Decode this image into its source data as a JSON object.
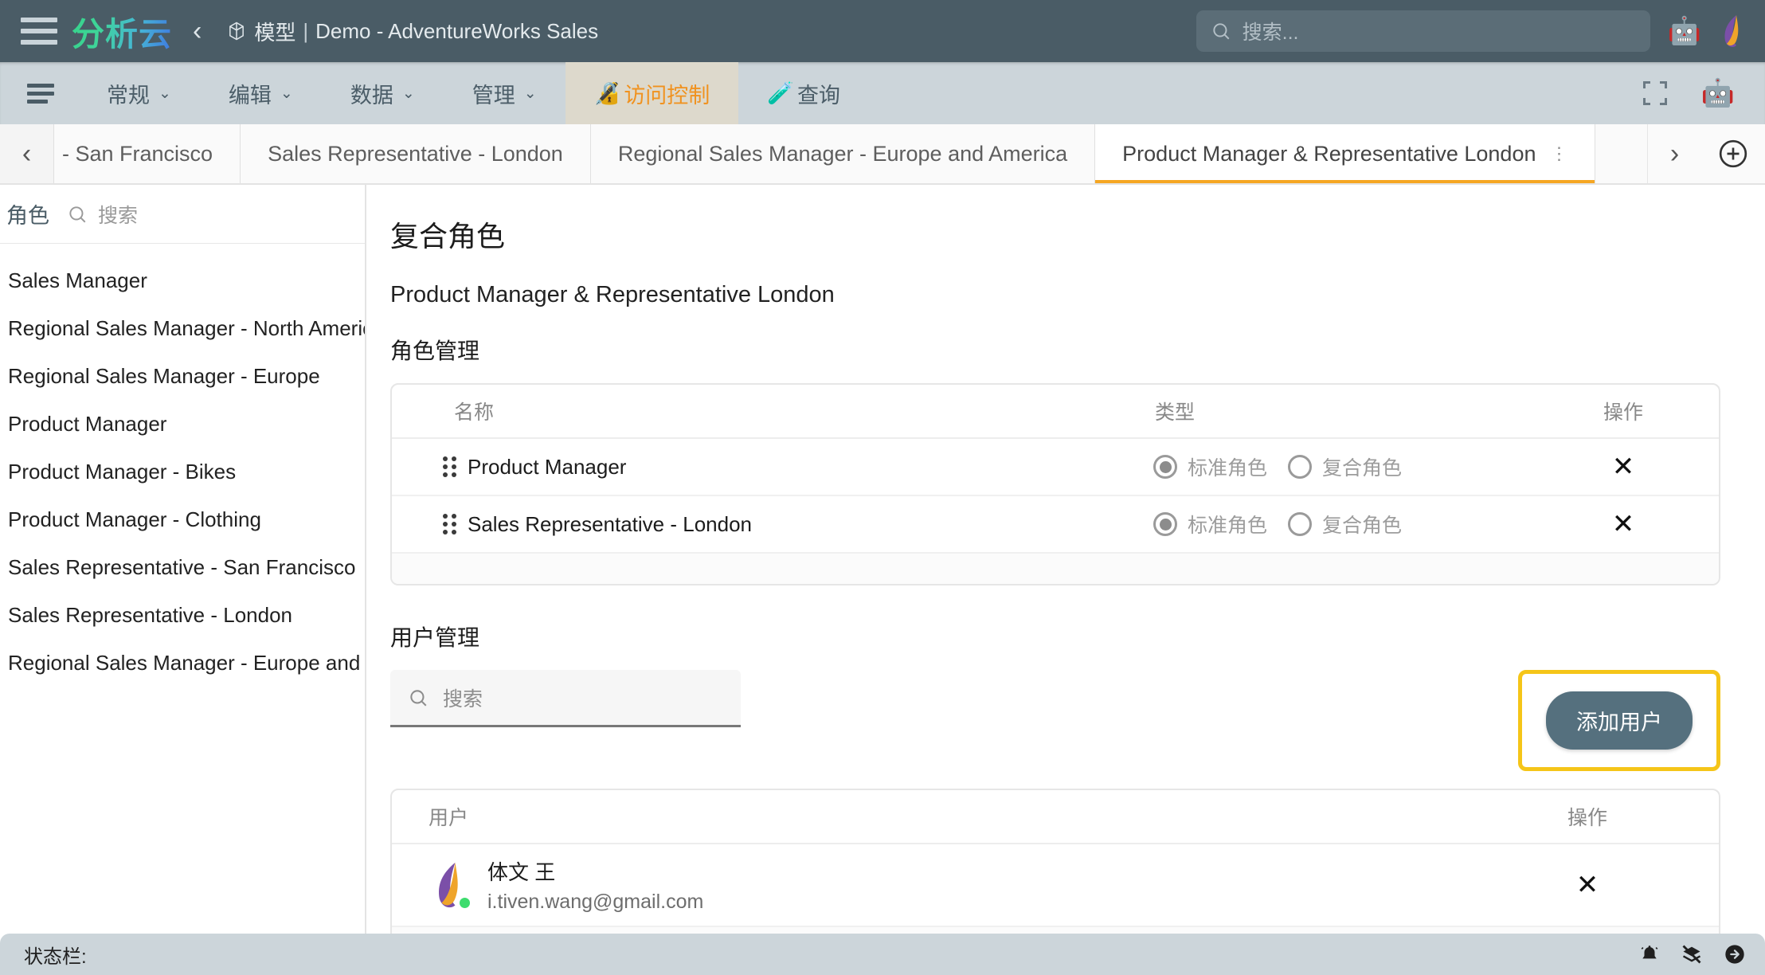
{
  "topbar": {
    "brand": "分析云",
    "back_icon": "‹",
    "model_label": "模型",
    "separator": "|",
    "document_title": "Demo - AdventureWorks Sales",
    "search_placeholder": "搜索...",
    "robot_emoji": "🤖"
  },
  "menubar": {
    "items": [
      {
        "label": "常规",
        "caret": "⌄",
        "active": false
      },
      {
        "label": "编辑",
        "caret": "⌄",
        "active": false
      },
      {
        "label": "数据",
        "caret": "⌄",
        "active": false
      },
      {
        "label": "管理",
        "caret": "⌄",
        "active": false
      }
    ],
    "access_control": {
      "label": "访问控制",
      "icon": "🔏"
    },
    "query": {
      "label": "查询",
      "icon": "🧪"
    }
  },
  "tabstrip": {
    "prev_arrow": "‹",
    "next_arrow": "›",
    "tabs": [
      {
        "label": "- San Francisco",
        "active": false
      },
      {
        "label": "Sales Representative - London",
        "active": false
      },
      {
        "label": "Regional Sales Manager - Europe and America",
        "active": false
      },
      {
        "label": "Product Manager & Representative London",
        "active": true,
        "kebab": "⋮"
      }
    ]
  },
  "sidebar": {
    "title": "角色",
    "search_placeholder": "搜索",
    "roles": [
      "Sales Manager",
      "Regional Sales Manager - North America",
      "Regional Sales Manager - Europe",
      "Product Manager",
      "Product Manager - Bikes",
      "Product Manager - Clothing",
      "Sales Representative - San Francisco",
      "Sales Representative - London",
      "Regional Sales Manager - Europe and A..."
    ]
  },
  "main": {
    "page_title": "复合角色",
    "page_subtitle": "Product Manager & Representative London",
    "role_section": {
      "title": "角色管理",
      "headers": {
        "name": "名称",
        "type": "类型",
        "action": "操作"
      },
      "type_options": {
        "standard": "标准角色",
        "composite": "复合角色"
      },
      "remove_icon": "✕",
      "rows": [
        {
          "name": "Product Manager",
          "type": "standard"
        },
        {
          "name": "Sales Representative - London",
          "type": "standard"
        }
      ]
    },
    "user_section": {
      "title": "用户管理",
      "search_placeholder": "搜索",
      "add_user_label": "添加用户",
      "highlight_color": "#f5c518",
      "headers": {
        "user": "用户",
        "action": "操作"
      },
      "remove_icon": "✕",
      "rows": [
        {
          "name": "体文 王",
          "email": "i.tiven.wang@gmail.com",
          "online": true
        }
      ]
    }
  },
  "statusbar": {
    "label": "状态栏:"
  }
}
